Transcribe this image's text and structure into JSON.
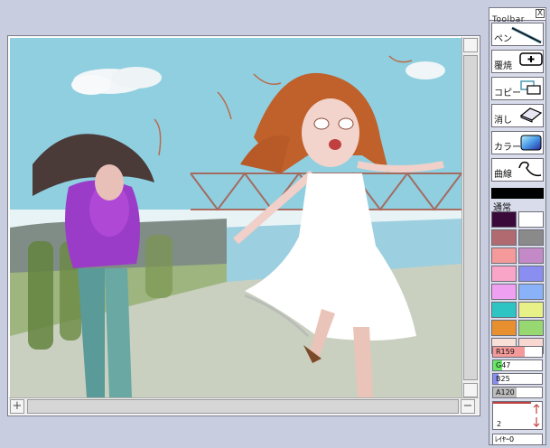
{
  "toolbar": {
    "title": "Toolbar",
    "close": "X",
    "tools": [
      {
        "id": "pen",
        "label": "ペン",
        "icon": "pen-icon"
      },
      {
        "id": "watercolor",
        "label": "覆焼",
        "icon": "plus-icon"
      },
      {
        "id": "copy",
        "label": "コピー",
        "icon": "copy-icon"
      },
      {
        "id": "eraser",
        "label": "消し",
        "icon": "eraser-icon"
      },
      {
        "id": "color",
        "label": "カラー",
        "icon": "color-icon"
      },
      {
        "id": "curve",
        "label": "曲線",
        "icon": "curve-icon"
      }
    ],
    "mode_label": "通常",
    "palette": [
      "#3a0a3a",
      "#ffffff",
      "#b06a70",
      "#8a8a8a",
      "#f59a9a",
      "#c48ac8",
      "#f8a5c8",
      "#8a8ef0",
      "#f0a0f0",
      "#8ab2f8",
      "#2ec4c4",
      "#e8f088",
      "#e89030",
      "#98d870",
      "#f8e0d8",
      "#f8d8d0"
    ],
    "sliders": [
      {
        "label": "R159",
        "value": 159,
        "color": "#f59a9a"
      },
      {
        "label": "G47",
        "value": 47,
        "color": "#68e868"
      },
      {
        "label": "B25",
        "value": 25,
        "color": "#8a8ef0"
      },
      {
        "label": "A120",
        "value": 120,
        "color": "#bbbbbb"
      }
    ],
    "brush_size": "2",
    "layer_label": "ﾚｲﾔｰ0"
  },
  "canvas": {
    "scroll_up_icon": "scroll-top-icon",
    "zoom_icon": "plus-icon",
    "scroll_end_icon": "minus-icon"
  }
}
